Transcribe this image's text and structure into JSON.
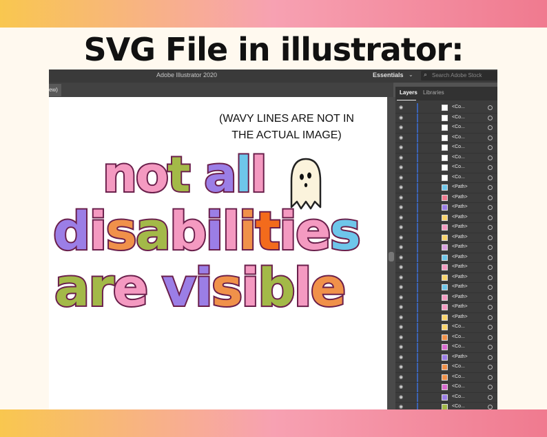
{
  "headline": "SVG File in illustrator:",
  "app": {
    "title": "Adobe Illustrator 2020",
    "workspace": "Essentials",
    "search_placeholder": "Search Adobe Stock",
    "doc_tab": "ew)"
  },
  "canvas": {
    "note_line1": "(WAVY LINES ARE NOT IN",
    "note_line2": "THE ACTUAL IMAGE)",
    "art_lines": [
      {
        "letters": [
          {
            "ch": "n",
            "color": "#f49ac1"
          },
          {
            "ch": "o",
            "color": "#f49ac1"
          },
          {
            "ch": "t",
            "color": "#a3b948"
          },
          {
            "ch": " ",
            "color": "#ffffff"
          },
          {
            "ch": "a",
            "color": "#9b7ee6"
          },
          {
            "ch": "l",
            "color": "#6ec6ea"
          },
          {
            "ch": "l",
            "color": "#f49ac1"
          }
        ]
      },
      {
        "letters": [
          {
            "ch": "d",
            "color": "#9b7ee6"
          },
          {
            "ch": "i",
            "color": "#f49ac1"
          },
          {
            "ch": "s",
            "color": "#f0914a"
          },
          {
            "ch": "a",
            "color": "#a3b948"
          },
          {
            "ch": "b",
            "color": "#f49ac1"
          },
          {
            "ch": "i",
            "color": "#9b7ee6"
          },
          {
            "ch": "l",
            "color": "#f49ac1"
          },
          {
            "ch": "i",
            "color": "#f0914a"
          },
          {
            "ch": "t",
            "color": "#f36b1c"
          },
          {
            "ch": "i",
            "color": "#f49ac1"
          },
          {
            "ch": "e",
            "color": "#f49ac1"
          },
          {
            "ch": "s",
            "color": "#6ec6ea"
          }
        ]
      },
      {
        "letters": [
          {
            "ch": "a",
            "color": "#a3b948"
          },
          {
            "ch": "r",
            "color": "#a3b948"
          },
          {
            "ch": "e",
            "color": "#f49ac1"
          },
          {
            "ch": " ",
            "color": "#ffffff"
          },
          {
            "ch": "v",
            "color": "#9b7ee6"
          },
          {
            "ch": "i",
            "color": "#9b7ee6"
          },
          {
            "ch": "s",
            "color": "#f0914a"
          },
          {
            "ch": "i",
            "color": "#f49ac1"
          },
          {
            "ch": "b",
            "color": "#a3b948"
          },
          {
            "ch": "l",
            "color": "#f49ac1"
          },
          {
            "ch": "e",
            "color": "#f0914a"
          }
        ]
      }
    ]
  },
  "panel": {
    "tabs": [
      "Layers",
      "Libraries"
    ],
    "rows": [
      {
        "label": "<Co...",
        "thumb": "#ffffff"
      },
      {
        "label": "<Co...",
        "thumb": "#ffffff"
      },
      {
        "label": "<Co...",
        "thumb": "#ffffff"
      },
      {
        "label": "<Co...",
        "thumb": "#ffffff"
      },
      {
        "label": "<Co...",
        "thumb": "#ffffff"
      },
      {
        "label": "<Co...",
        "thumb": "#ffffff"
      },
      {
        "label": "<Co...",
        "thumb": "#ffffff"
      },
      {
        "label": "<Co...",
        "thumb": "#ffffff"
      },
      {
        "label": "<Path>",
        "thumb": "#6ec6ea"
      },
      {
        "label": "<Path>",
        "thumb": "#f07a8f"
      },
      {
        "label": "<Path>",
        "thumb": "#9b7ee6"
      },
      {
        "label": "<Path>",
        "thumb": "#f9d36b"
      },
      {
        "label": "<Path>",
        "thumb": "#f49ac1"
      },
      {
        "label": "<Path>",
        "thumb": "#f9d36b"
      },
      {
        "label": "<Path>",
        "thumb": "#d8a0e0"
      },
      {
        "label": "<Path>",
        "thumb": "#6ec6ea"
      },
      {
        "label": "<Path>",
        "thumb": "#f49ac1"
      },
      {
        "label": "<Path>",
        "thumb": "#f9d36b"
      },
      {
        "label": "<Path>",
        "thumb": "#6ec6ea"
      },
      {
        "label": "<Path>",
        "thumb": "#f49ac1"
      },
      {
        "label": "<Path>",
        "thumb": "#f49ac1"
      },
      {
        "label": "<Path>",
        "thumb": "#f9d36b"
      },
      {
        "label": "<Co...",
        "thumb": "#f9d36b"
      },
      {
        "label": "<Co...",
        "thumb": "#f0914a"
      },
      {
        "label": "<Co...",
        "thumb": "#d86ad0"
      },
      {
        "label": "<Path>",
        "thumb": "#9b7ee6"
      },
      {
        "label": "<Co...",
        "thumb": "#f0914a"
      },
      {
        "label": "<Co...",
        "thumb": "#f0914a"
      },
      {
        "label": "<Co...",
        "thumb": "#d86ad0"
      },
      {
        "label": "<Co...",
        "thumb": "#9b7ee6"
      },
      {
        "label": "<Co...",
        "thumb": "#a3b948"
      },
      {
        "label": "<Path>",
        "thumb": "#f36b1c"
      },
      {
        "label": "<Path>",
        "thumb": "#6ec6ea"
      }
    ]
  }
}
